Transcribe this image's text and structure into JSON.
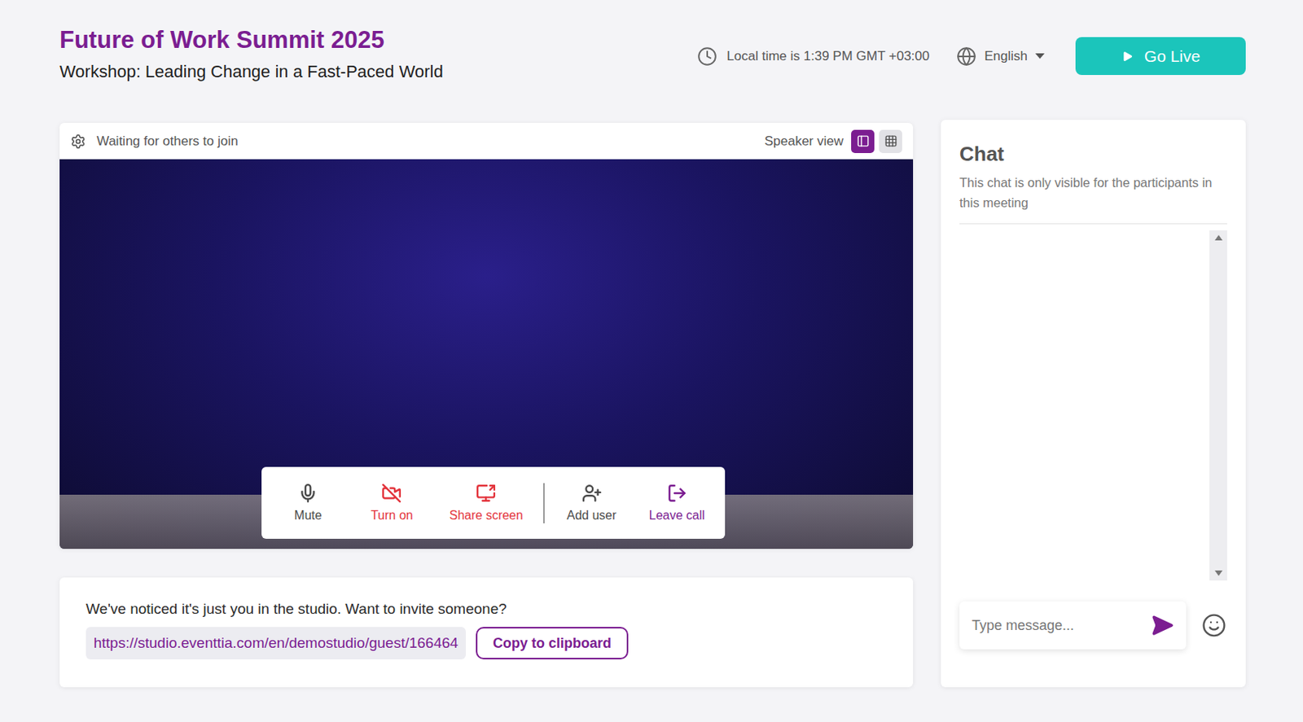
{
  "header": {
    "title": "Future of Work Summit 2025",
    "subtitle": "Workshop: Leading Change in a Fast-Paced World",
    "local_time": "Local time is 1:39 PM GMT +03:00",
    "language": "English",
    "go_live": "Go Live"
  },
  "stage": {
    "status": "Waiting for others to join",
    "view_label": "Speaker view",
    "views": [
      {
        "kind": "speaker",
        "selected": true
      },
      {
        "kind": "grid",
        "selected": false
      }
    ],
    "controls": [
      {
        "kind": "mute",
        "label": "Mute",
        "color": "#4a4a4a"
      },
      {
        "kind": "camera",
        "label": "Turn on",
        "color": "#e3343c"
      },
      {
        "kind": "share",
        "label": "Share screen",
        "color": "#e3343c"
      },
      {
        "kind": "add-user",
        "label": "Add user",
        "color": "#4a4a4a"
      },
      {
        "kind": "leave",
        "label": "Leave call",
        "color": "#7b1d91"
      }
    ]
  },
  "invite": {
    "message": "We've noticed it's just you in the studio. Want to invite someone?",
    "link": "https://studio.eventtia.com/en/demostudio/guest/166464",
    "copy_button": "Copy to clipboard"
  },
  "chat": {
    "title": "Chat",
    "note": "This chat is only visible for the participants in this meeting",
    "placeholder": "Type message...",
    "messages": []
  }
}
